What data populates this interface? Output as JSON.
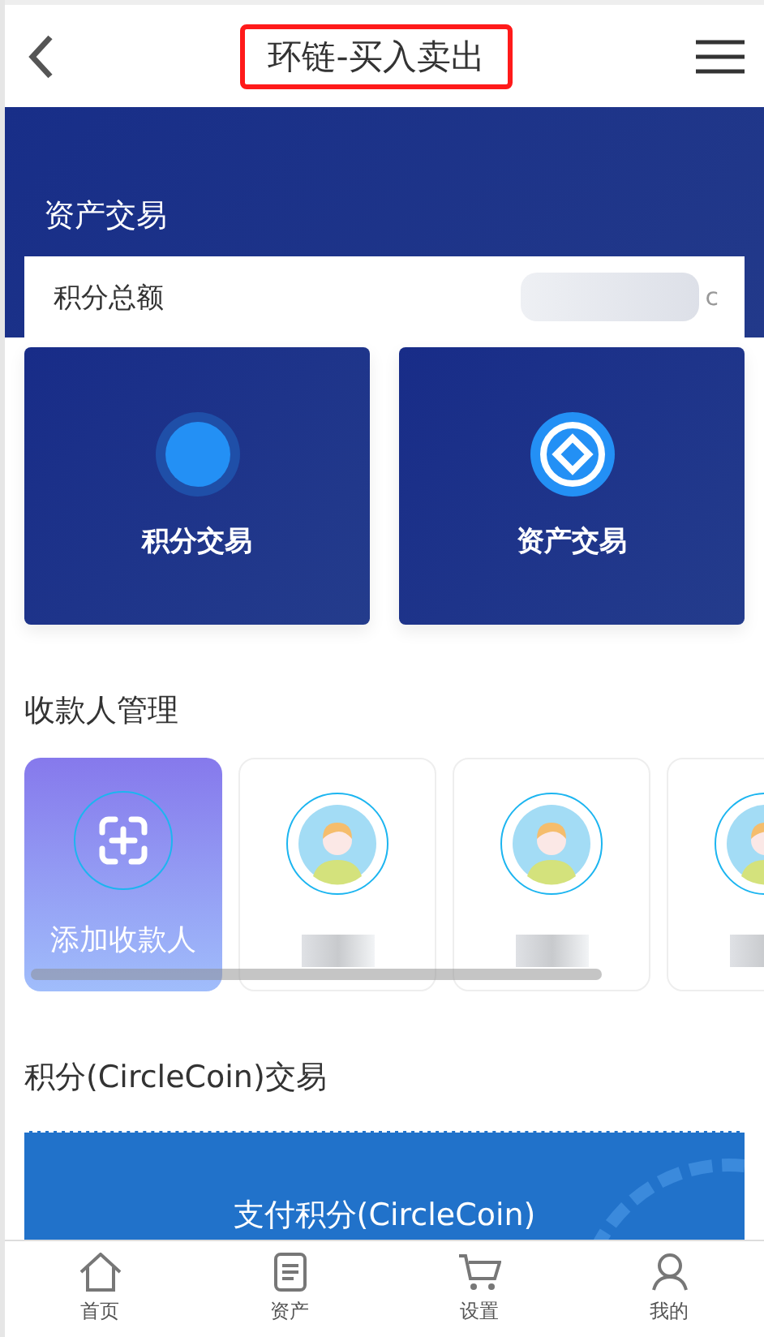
{
  "header": {
    "title": "环链-买入卖出",
    "title_highlighted": true
  },
  "banner": {
    "title": "资产交易"
  },
  "total": {
    "label": "积分总额",
    "value_suffix": "c"
  },
  "tiles": [
    {
      "label": "积分交易",
      "kind": "dot"
    },
    {
      "label": "资产交易",
      "kind": "diamond"
    }
  ],
  "payees": {
    "title": "收款人管理",
    "items": [
      {
        "kind": "add",
        "label": "添加收款人"
      },
      {
        "kind": "person"
      },
      {
        "kind": "person"
      },
      {
        "kind": "person"
      }
    ]
  },
  "trade": {
    "title": "积分(CircleCoin)交易",
    "card_label": "支付积分(CircleCoin)"
  },
  "tabbar": [
    {
      "label": "首页",
      "kind": "home"
    },
    {
      "label": "资产",
      "kind": "doc"
    },
    {
      "label": "设置",
      "kind": "cart"
    },
    {
      "label": "我的",
      "kind": "user"
    }
  ]
}
